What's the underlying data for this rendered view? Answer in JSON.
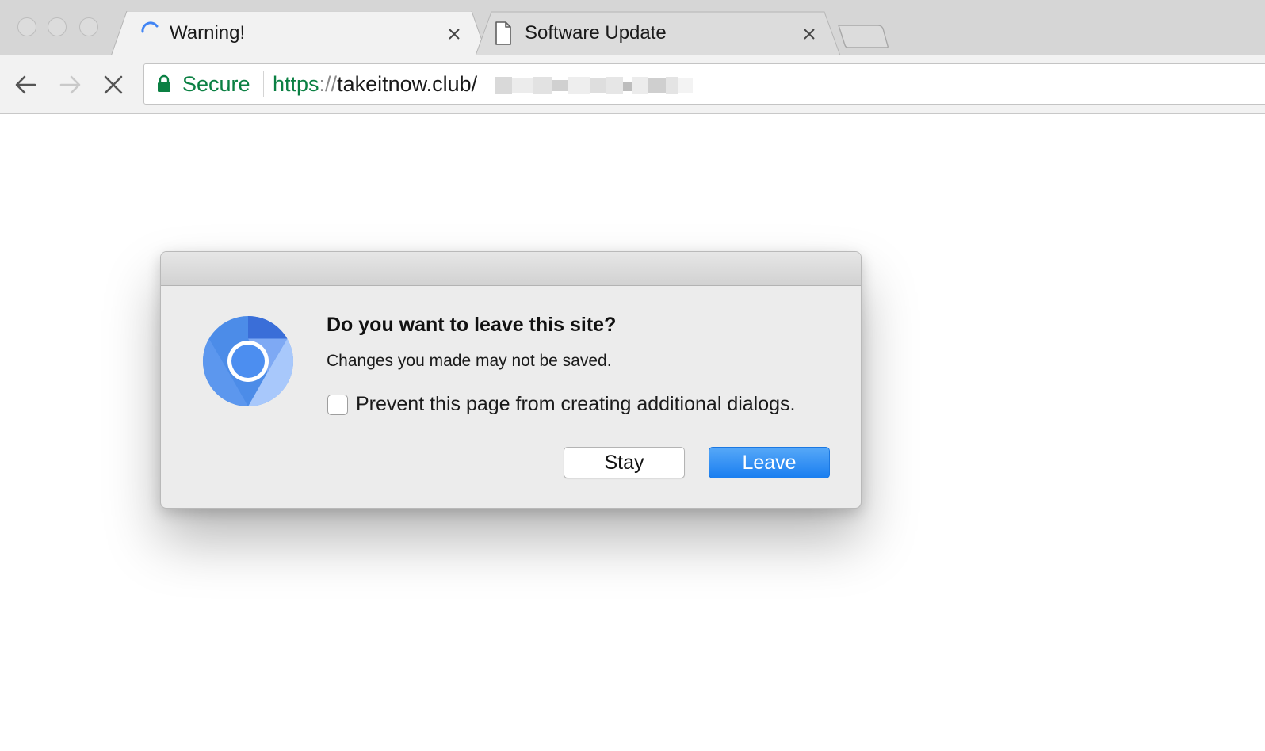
{
  "window": {
    "traffic_lights": [
      "close",
      "minimize",
      "zoom"
    ]
  },
  "tabs": [
    {
      "title": "Warning!",
      "icon": "loading-spinner-icon",
      "active": true
    },
    {
      "title": "Software Update",
      "icon": "page-icon",
      "active": false
    }
  ],
  "toolbar": {
    "back_icon": "back-arrow-icon",
    "forward_icon": "forward-arrow-icon",
    "stop_icon": "stop-icon"
  },
  "omnibox": {
    "secure_label": "Secure",
    "url_scheme": "https",
    "url_separator": "://",
    "url_host_path": "takeitnow.club/"
  },
  "dialog": {
    "title": "Do you want to leave this site?",
    "message": "Changes you made may not be saved.",
    "checkbox_label": "Prevent this page from creating additional dialogs.",
    "checkbox_checked": false,
    "stay_label": "Stay",
    "leave_label": "Leave",
    "icon": "chromium-logo-icon"
  },
  "colors": {
    "secure_green": "#0b8043",
    "accent_blue": "#1a7ef0",
    "spinner_blue": "#4285f4"
  }
}
